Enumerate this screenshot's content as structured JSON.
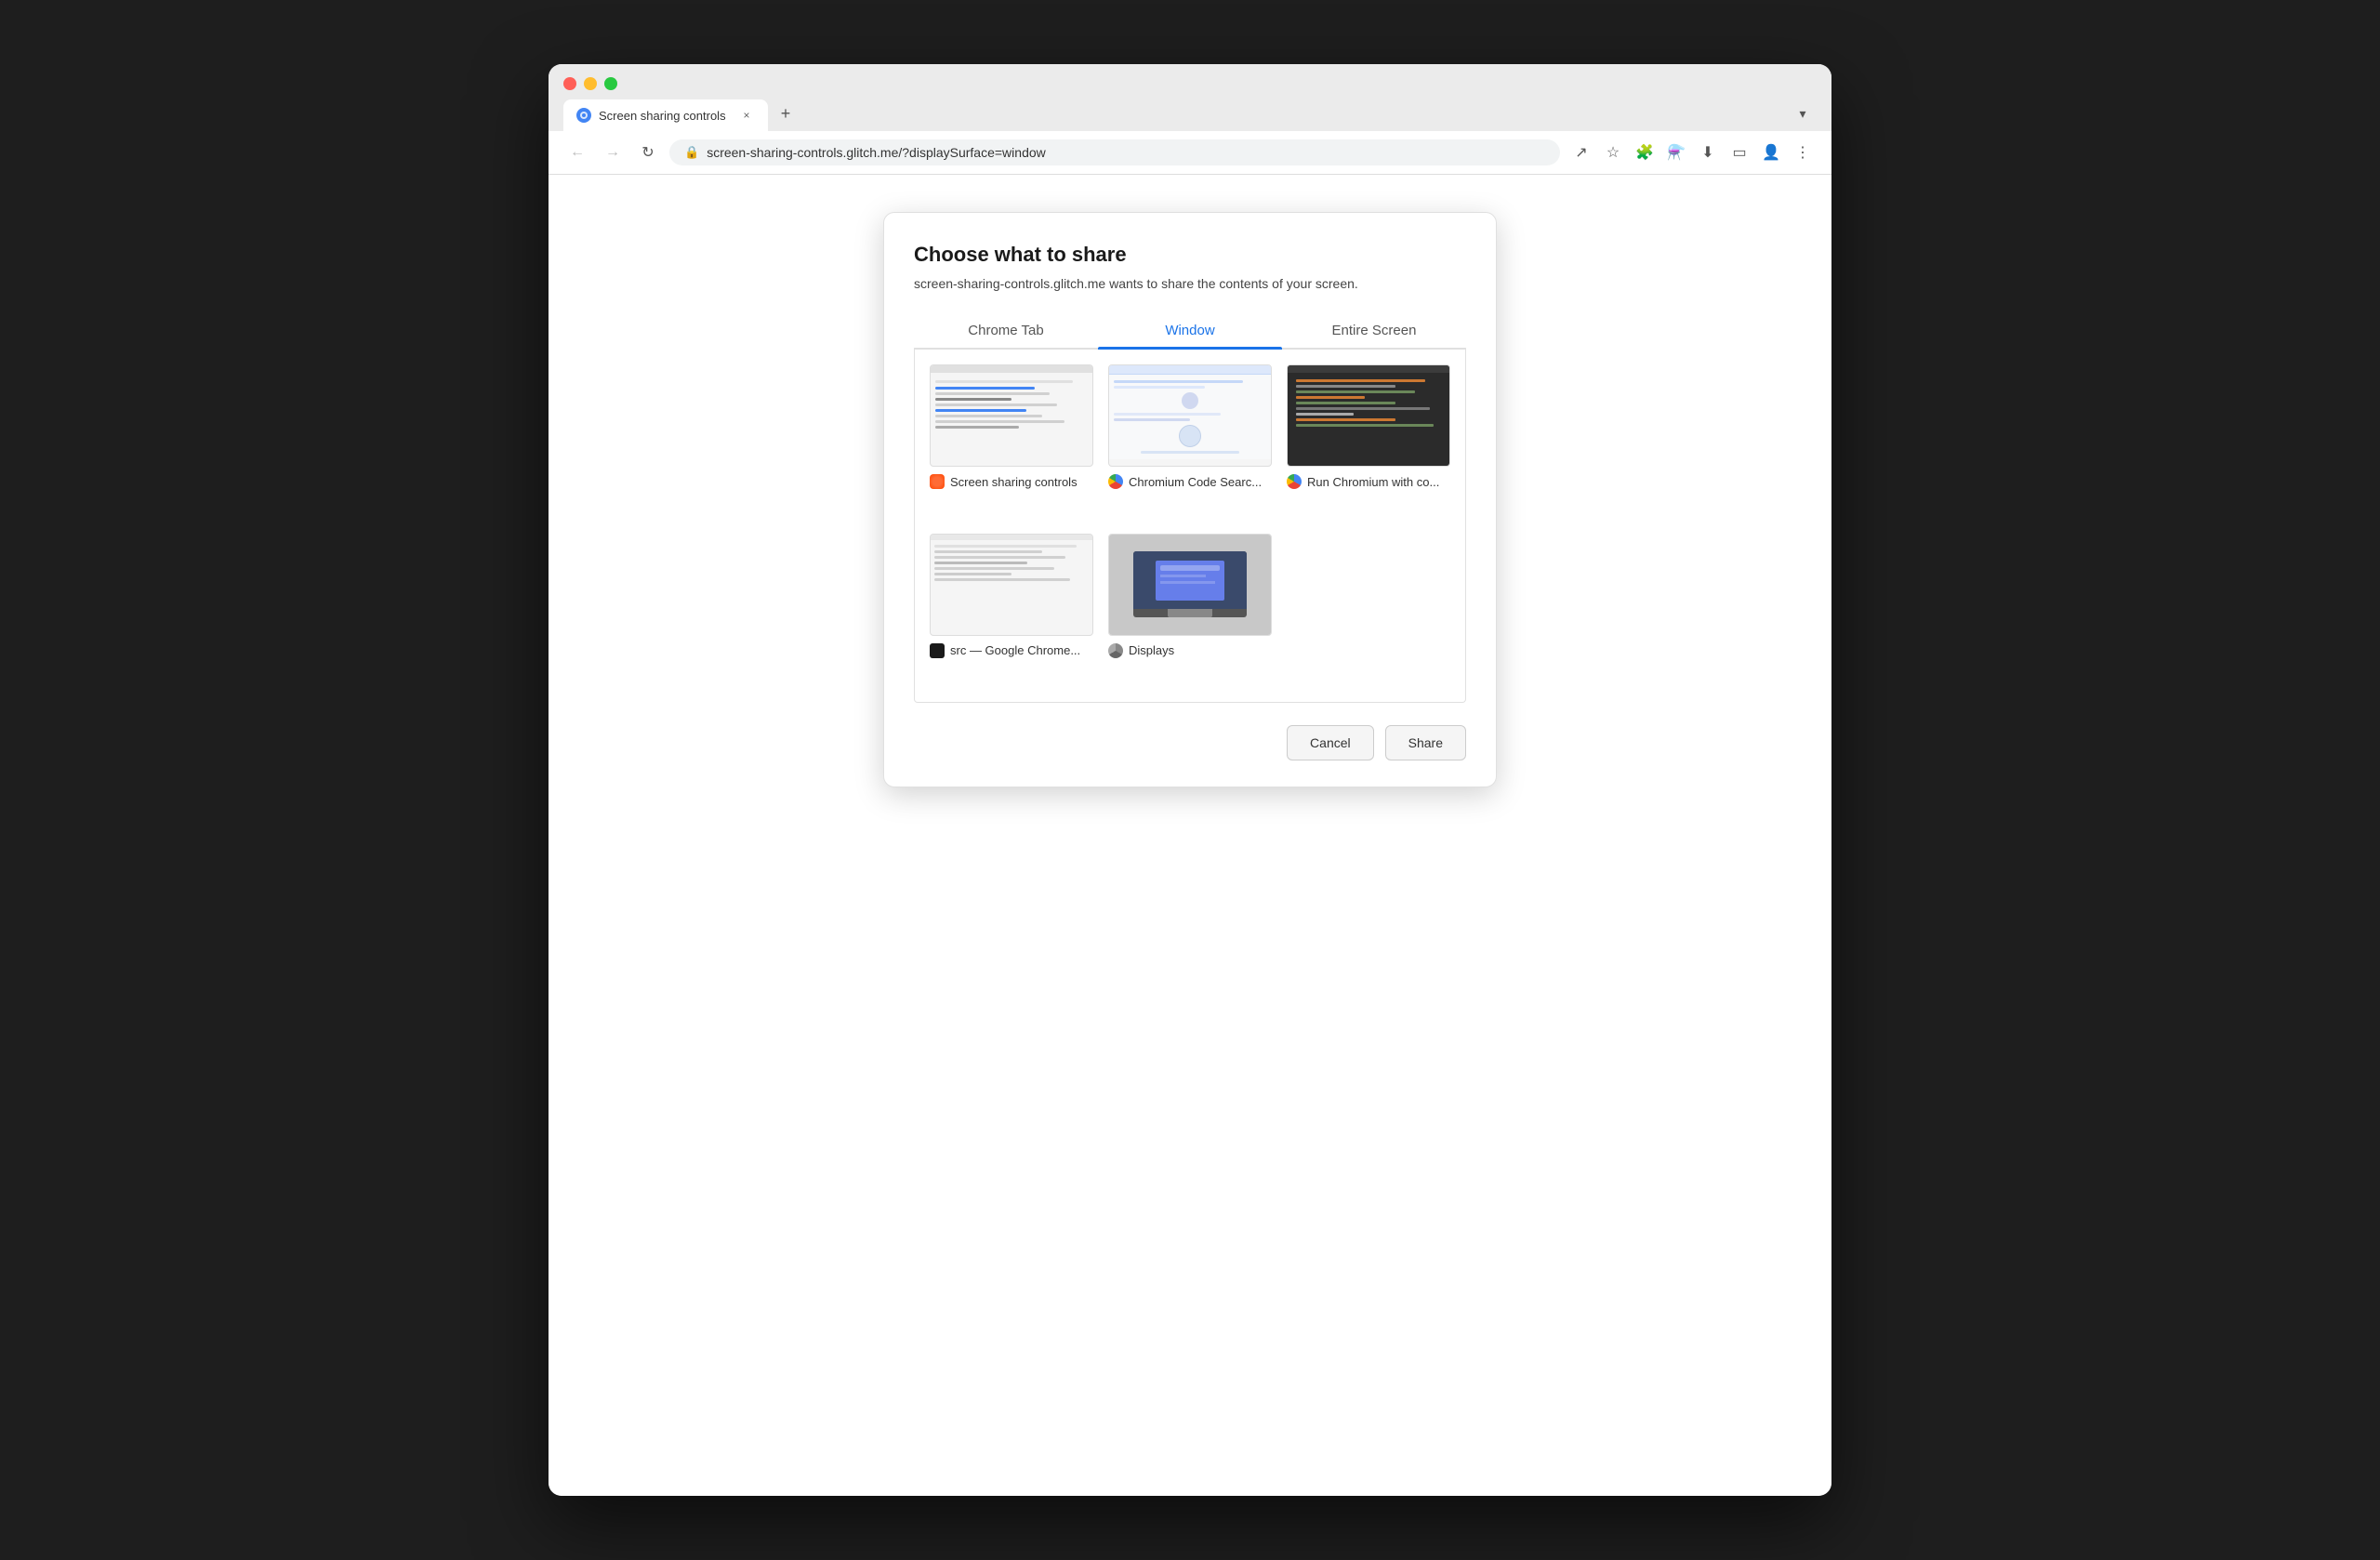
{
  "browser": {
    "tab_title": "Screen sharing controls",
    "url": "screen-sharing-controls.glitch.me/?displaySurface=window",
    "new_tab_label": "+",
    "dropdown_label": "▾",
    "nav": {
      "back_disabled": true,
      "forward_disabled": true
    }
  },
  "dialog": {
    "title": "Choose what to share",
    "subtitle": "screen-sharing-controls.glitch.me wants to share the contents of your screen.",
    "tabs": [
      {
        "id": "chrome-tab",
        "label": "Chrome Tab",
        "active": false
      },
      {
        "id": "window",
        "label": "Window",
        "active": true
      },
      {
        "id": "entire-screen",
        "label": "Entire Screen",
        "active": false
      }
    ],
    "windows": [
      {
        "id": "w1",
        "label": "Screen sharing controls",
        "icon_type": "glitch",
        "preview_type": "browser-light"
      },
      {
        "id": "w2",
        "label": "Chromium Code Searc...",
        "icon_type": "chrome",
        "preview_type": "browser-search"
      },
      {
        "id": "w3",
        "label": "Run Chromium with co...",
        "icon_type": "chrome",
        "preview_type": "code-dark"
      },
      {
        "id": "w4",
        "label": "src — Google Chrome...",
        "icon_type": "terminal",
        "preview_type": "browser-light2"
      },
      {
        "id": "w5",
        "label": "Displays",
        "icon_type": "displays",
        "preview_type": "displays"
      }
    ],
    "buttons": {
      "cancel": "Cancel",
      "share": "Share"
    }
  }
}
